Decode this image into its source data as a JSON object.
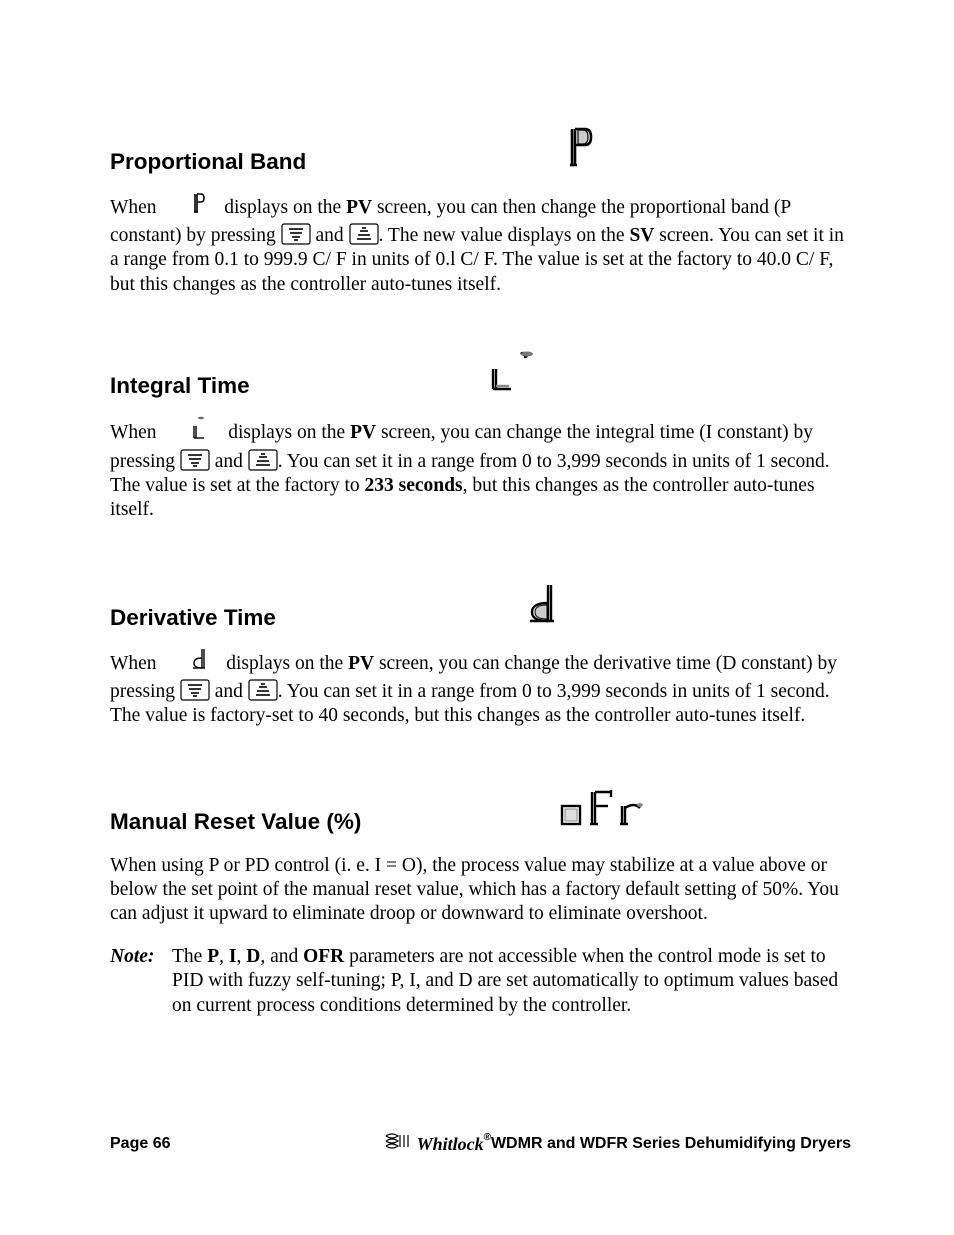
{
  "sections": {
    "pb": {
      "heading": "Proportional Band",
      "p1_a": "When ",
      "p1_b": " displays on the ",
      "pv": "PV",
      "p1_c": " screen, you can then change the proportional band (P constant) by pressing ",
      "and": " and ",
      "p1_d": ". The new value displays on the ",
      "sv": "SV",
      "p1_e": " screen. You can set it in a range from 0.1  to 999.9  C/ F in units of 0.l C/ F. The value is set at the factory to 40.0  C/  F, but this changes as the controller auto-tunes itself."
    },
    "it": {
      "heading": "Integral Time",
      "p1_a": "When ",
      "p1_b": " displays on the ",
      "pv": "PV",
      "p1_c": " screen, you can change the integral time (I constant) by pressing ",
      "and": " and ",
      "p1_d_a": ". You can set it in a range from 0 to 3,999 seconds in units of 1 second. The value is set at the factory to ",
      "p1_bold": "233 seconds",
      "p1_e": ", but this changes as the controller auto-tunes itself."
    },
    "dt": {
      "heading": "Derivative Time",
      "p1_a": "When ",
      "p1_b": " displays on the ",
      "pv": "PV",
      "p1_c": " screen, you can change the derivative time (D constant) by pressing ",
      "and": " and ",
      "p1_d": ". You can set it in a range from 0 to 3,999 seconds in units of 1 second. The value is factory-set to 40 seconds, but this changes as the controller auto-tunes itself."
    },
    "mrv": {
      "heading": "Manual Reset Value (%)",
      "p1": "When using P or PD control (i. e. I = O), the process value may stabilize at a value above or below the set point of the manual reset value, which has a factory default setting of 50%. You can adjust it upward to eliminate droop or downward to eliminate overshoot."
    },
    "note": {
      "label": "Note:",
      "a": "The ",
      "P": "P",
      "c1": ", ",
      "I": "I",
      "c2": ", ",
      "D": "D",
      "c3": ", and ",
      "OFR": "OFR",
      "rest": " parameters are not accessible when the control mode is set to PID with fuzzy self-tuning; P, I, and D are set automatically to optimum values based on current process conditions determined by the controller."
    }
  },
  "footer": {
    "page": "Page 66",
    "brand": "Whitlock",
    "title": " WDMR and WDFR Series Dehumidifying Dryers"
  }
}
